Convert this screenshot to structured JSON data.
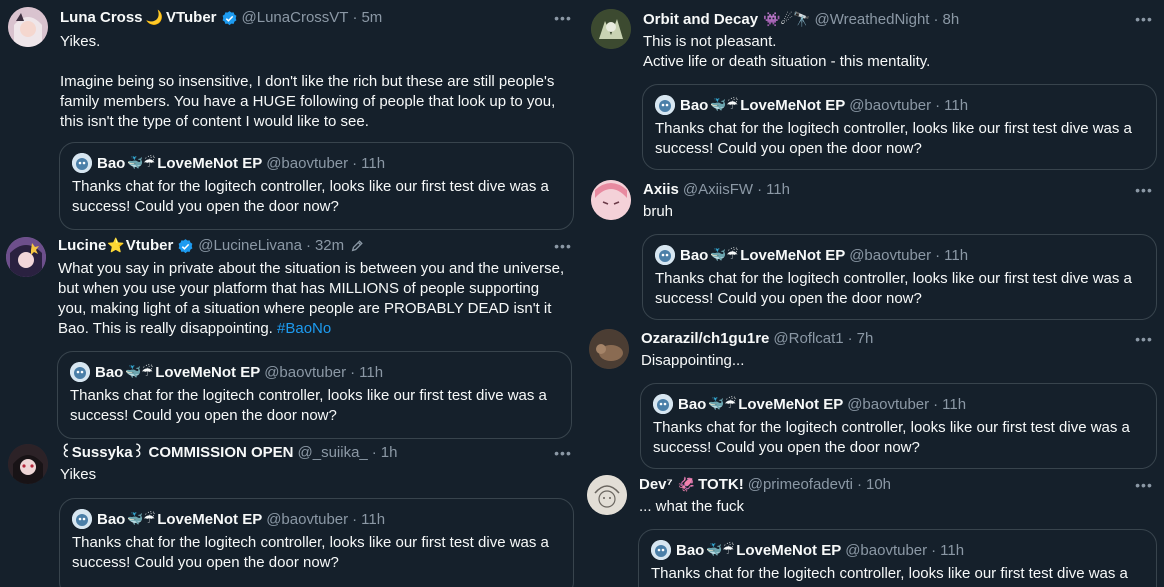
{
  "quoted_tweet": {
    "name": "Bao",
    "name_suffix": "LoveMeNot EP",
    "emoji": "🐳☔",
    "handle": "@baovtuber",
    "time": "11h",
    "text": "Thanks chat for the logitech controller, looks like our first test dive was a success! Could you open the door now?"
  },
  "left_column": [
    {
      "name": "Luna Cross",
      "emoji": "🌙",
      "name_suffix": "VTuber",
      "verified": true,
      "handle": "@LunaCrossVT",
      "time": "5m",
      "text": "Yikes.\n\nImagine being so insensitive, I don't like the rich but these are still people's family members. You have a HUGE following of people that look up to you, this isn't the type of content I would like to see.",
      "avatar_color": "#c9a7b7"
    },
    {
      "name": "Lucine",
      "emoji": "⭐",
      "name_suffix": "Vtuber",
      "verified": true,
      "handle": "@LucineLivana",
      "time": "32m",
      "text": "What you say in private about the situation is between you and the universe, but when you use your platform that has MILLIONS of people supporting you, making light of a situation where people are PROBABLY DEAD isn't it Bao. This is really disappointing. ",
      "hashtag": "#BaoNo",
      "avatar_color": "#8e6fa8"
    },
    {
      "name": "꒰Sussyka꒱ COMMISSION OPEN",
      "handle": "@_suiika_",
      "time": "1h",
      "text": "Yikes",
      "avatar_color": "#3a2a33"
    }
  ],
  "right_column": [
    {
      "name": "Orbit and Decay",
      "emoji": "👾☄🔭",
      "handle": "@WreathedNight",
      "time": "8h",
      "text": "This is not pleasant.\nActive life or death situation - this mentality.",
      "avatar_color": "#4a5a3a"
    },
    {
      "name": "Axiis",
      "handle": "@AxiisFW",
      "time": "11h",
      "text": "bruh",
      "avatar_color": "#f2c6cf"
    },
    {
      "name": "Ozarazil/ch1gu1re",
      "handle": "@Roflcat1",
      "time": "7h",
      "text": "Disappointing...",
      "avatar_color": "#5b4a3e"
    },
    {
      "name": "Dev⁷",
      "emoji": "🦑",
      "name_suffix": "TOTK!",
      "handle": "@primeofadevti",
      "time": "10h",
      "text": "... what the fuck",
      "avatar_color": "#d8d4cc"
    }
  ],
  "ui": {
    "more_label": "•••",
    "dot": "·"
  },
  "colors": {
    "background": "#15202b",
    "text_primary": "#f7f9f9",
    "text_secondary": "#8b98a5",
    "accent": "#1d9bf0",
    "border": "#38444d"
  }
}
